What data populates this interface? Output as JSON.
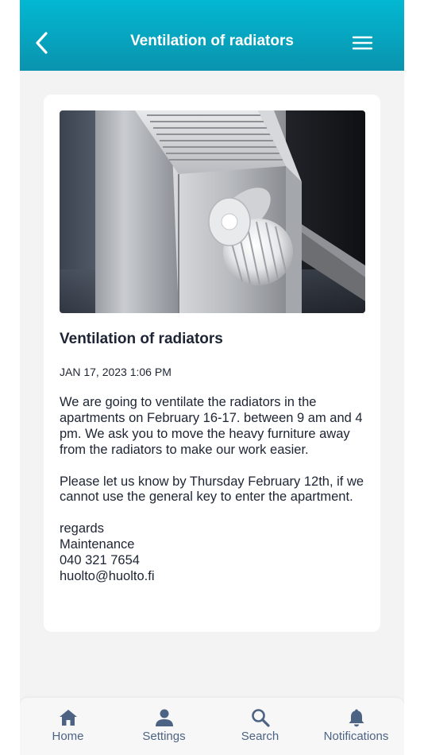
{
  "header": {
    "title": "Ventilation of radiators",
    "back_icon": "chevron-left-icon",
    "menu_icon": "hamburger-menu-icon",
    "gradient_top": "#03b8d2",
    "gradient_bottom": "#0a93ae"
  },
  "post": {
    "image": "radiator-thermostat-photo",
    "title": "Ventilation of radiators",
    "date": "JAN 17, 2023 1:06 PM",
    "paragraphs": [
      "We are going to ventilate the radiators in the apartments on February 16-17. between 9 am and 4 pm. We ask you to move the heavy furniture away from the radiators to make our work easier.",
      "Please let us know by Thursday February 12th, if we cannot use the general key to enter the apartment."
    ],
    "signature": [
      "regards",
      "Maintenance",
      "040 321 7654",
      "huolto@huolto.fi"
    ]
  },
  "nav": {
    "color": "#4d6384",
    "items": [
      {
        "label": "Home",
        "icon": "home-icon"
      },
      {
        "label": "Settings",
        "icon": "person-icon"
      },
      {
        "label": "Search",
        "icon": "search-icon"
      },
      {
        "label": "Notifications",
        "icon": "bell-icon"
      }
    ]
  }
}
